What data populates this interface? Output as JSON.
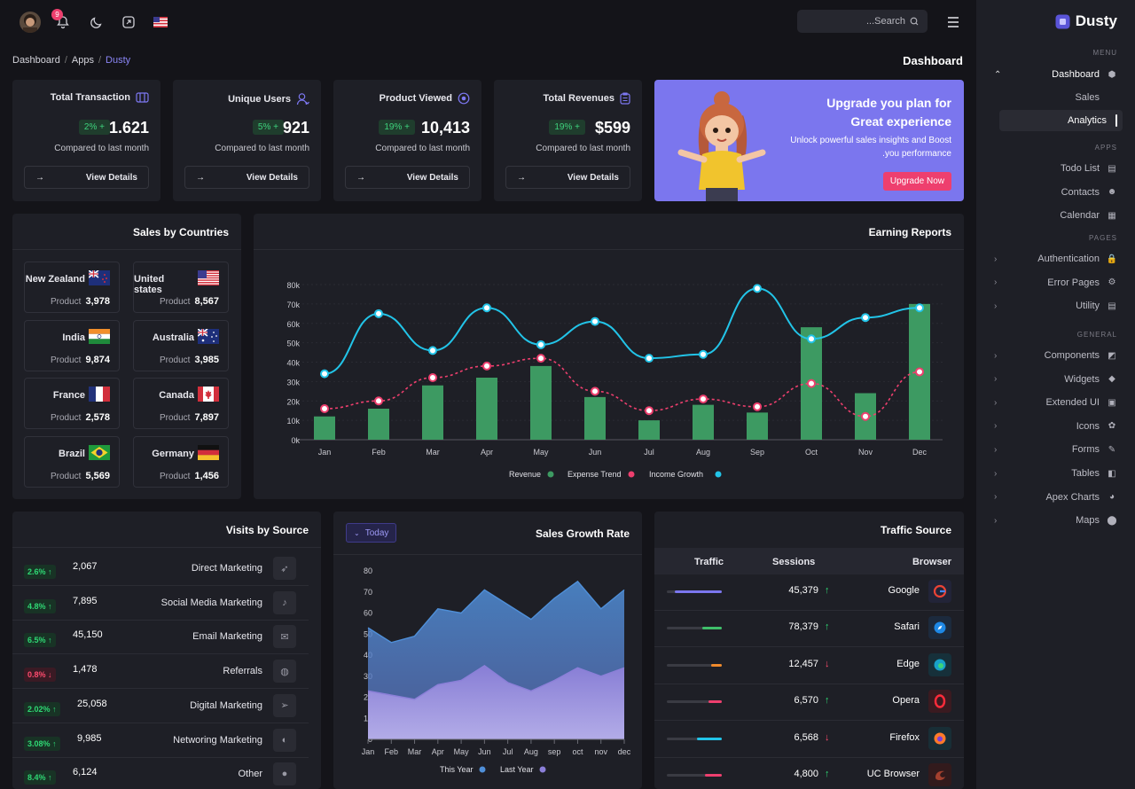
{
  "header": {
    "notif_count": "9",
    "search_placeholder": "...Search"
  },
  "breadcrumb": {
    "items": [
      "Dashboard",
      "Apps",
      "Dusty"
    ]
  },
  "page_title": "Dashboard",
  "stats": [
    {
      "title": "Total Transaction",
      "icon": "columns-icon",
      "value": "1.621",
      "pct": "2% +",
      "compare": "Compared to last month",
      "view": "View Details"
    },
    {
      "title": "Unique Users",
      "icon": "user-icon",
      "value": "921",
      "pct": "5% +",
      "compare": "Compared to last month",
      "view": "View Details"
    },
    {
      "title": "Product Viewed",
      "icon": "eye-icon",
      "value": "10,413",
      "pct": "19% +",
      "compare": "Compared to last month",
      "view": "View Details"
    },
    {
      "title": "Total Revenues",
      "icon": "clipboard-icon",
      "value": "$599",
      "pct": "19% +",
      "compare": "Compared to last month",
      "view": "View Details"
    }
  ],
  "promo": {
    "title_line1": "Upgrade you plan for",
    "title_line2": "Great experience",
    "sub_line1": "Unlock powerful sales insights and Boost",
    "sub_line2": ".you performance",
    "button": "Upgrade Now"
  },
  "countries": {
    "title": "Sales by Countries",
    "product_label": "Product",
    "items": [
      {
        "name": "New Zealand",
        "value": "3,978",
        "flag": "nz"
      },
      {
        "name": "United states",
        "value": "8,567",
        "flag": "us"
      },
      {
        "name": "India",
        "value": "9,874",
        "flag": "in"
      },
      {
        "name": "Australia",
        "value": "3,985",
        "flag": "au"
      },
      {
        "name": "France",
        "value": "2,578",
        "flag": "fr"
      },
      {
        "name": "Canada",
        "value": "7,897",
        "flag": "ca"
      },
      {
        "name": "Brazil",
        "value": "5,569",
        "flag": "br"
      },
      {
        "name": "Germany",
        "value": "1,456",
        "flag": "de"
      }
    ]
  },
  "earning": {
    "title": "Earning Reports"
  },
  "chart_data": [
    {
      "type": "bar",
      "title": "Earning Reports",
      "categories": [
        "Jan",
        "Feb",
        "Mar",
        "Apr",
        "May",
        "Jun",
        "Jul",
        "Aug",
        "Sep",
        "Oct",
        "Nov",
        "Dec"
      ],
      "ylim": [
        0,
        80000
      ],
      "yticks": [
        "0k",
        "10k",
        "20k",
        "30k",
        "40k",
        "50k",
        "60k",
        "70k",
        "80k"
      ],
      "legend": "bottom-center",
      "series": [
        {
          "name": "Revenue",
          "type": "bar",
          "color": "#3d9a62",
          "values": [
            12000,
            16000,
            28000,
            32000,
            38000,
            22000,
            10000,
            18000,
            14000,
            58000,
            24000,
            70000
          ]
        },
        {
          "name": "Expense Trend",
          "type": "line-dashed",
          "color": "#ee3f6e",
          "values": [
            16000,
            20000,
            32000,
            38000,
            42000,
            25000,
            15000,
            21000,
            17000,
            29000,
            12000,
            35000
          ]
        },
        {
          "name": "Income Growth",
          "type": "line",
          "color": "#22c4e8",
          "values": [
            34000,
            65000,
            46000,
            68000,
            49000,
            61000,
            42000,
            44000,
            78000,
            52000,
            63000,
            68000
          ]
        }
      ]
    },
    {
      "type": "area",
      "title": "Sales Growth Rate",
      "categories": [
        "Jan",
        "Feb",
        "Mar",
        "Apr",
        "May",
        "Jun",
        "Jul",
        "Aug",
        "sep",
        "oct",
        "nov",
        "dec"
      ],
      "ylim": [
        0,
        80
      ],
      "yticks": [
        "0",
        "10",
        "20",
        "30",
        "40",
        "50",
        "60",
        "70",
        "80"
      ],
      "legend": "bottom-center",
      "series": [
        {
          "name": "This Year",
          "color": "#4f8fd8",
          "values": [
            53,
            46,
            49,
            62,
            60,
            71,
            64,
            57,
            67,
            75,
            62,
            71
          ]
        },
        {
          "name": "Last Year",
          "color": "#8b7fd8",
          "values": [
            23,
            21,
            19,
            26,
            28,
            35,
            27,
            23,
            28,
            34,
            30,
            34
          ]
        }
      ]
    }
  ],
  "visits": {
    "title": "Visits by Source",
    "rows": [
      {
        "pct": "2.6% ↑",
        "dir": "up",
        "num": "2,067",
        "label": "Direct Marketing",
        "icon": "rocket-icon",
        "glyph": "➶"
      },
      {
        "pct": "4.8% ↑",
        "dir": "up",
        "num": "7,895",
        "label": "Social Media Marketing",
        "icon": "music-icon",
        "glyph": "♪"
      },
      {
        "pct": "6.5% ↑",
        "dir": "up",
        "num": "45,150",
        "label": "Email Marketing",
        "icon": "mail-icon",
        "glyph": "✉"
      },
      {
        "pct": "0.8% ↓",
        "dir": "down",
        "num": "1,478",
        "label": "Referrals",
        "icon": "globe-icon",
        "glyph": "◍"
      },
      {
        "pct": "2.02% ↑",
        "dir": "up",
        "num": "25,058",
        "label": "Digital Marketing",
        "icon": "send-icon",
        "glyph": "➢"
      },
      {
        "pct": "3.08% ↑",
        "dir": "up",
        "num": "9,985",
        "label": "Networing Marketing",
        "icon": "planet-icon",
        "glyph": "◐"
      },
      {
        "pct": "8.4% ↑",
        "dir": "up",
        "num": "6,124",
        "label": "Other",
        "icon": "fire-icon",
        "glyph": "●"
      }
    ]
  },
  "sales_growth": {
    "title": "Sales Growth Rate",
    "filter": "Today",
    "legend": [
      "This Year",
      "Last Year"
    ]
  },
  "traffic": {
    "title": "Traffic Source",
    "headers": [
      "Traffic",
      "Sessions",
      "Browser"
    ],
    "rows": [
      {
        "sessions": "45,379",
        "dir": "up",
        "browser": "Google",
        "color": "#7b76ee",
        "fill": 0.85,
        "icon_bg": "#222438"
      },
      {
        "sessions": "78,379",
        "dir": "up",
        "browser": "Safari",
        "color": "#3fbf6a",
        "fill": 0.35,
        "icon_bg": "#1c2a3d"
      },
      {
        "sessions": "12,457",
        "dir": "down",
        "browser": "Edge",
        "color": "#f08a2c",
        "fill": 0.2,
        "icon_bg": "#16303a"
      },
      {
        "sessions": "6,570",
        "dir": "up",
        "browser": "Opera",
        "color": "#ee3f6e",
        "fill": 0.25,
        "icon_bg": "#3a1a20"
      },
      {
        "sessions": "6,568",
        "dir": "down",
        "browser": "Firefox",
        "color": "#22c4e8",
        "fill": 0.45,
        "icon_bg": "#182e36"
      },
      {
        "sessions": "4,800",
        "dir": "up",
        "browser": "UC Browser",
        "color": "#ee3f6e",
        "fill": 0.3,
        "icon_bg": "#321a1c"
      }
    ]
  },
  "sidebar": {
    "brand": "Dusty",
    "sections": {
      "menu": "MENU",
      "apps": "APPS",
      "pages": "PAGES",
      "general": "GENERAL"
    },
    "dashboard": "Dashboard",
    "sub": [
      "Sales",
      "Analytics"
    ],
    "apps": [
      {
        "label": "Todo List",
        "icon": "list-icon",
        "glyph": "▤"
      },
      {
        "label": "Contacts",
        "icon": "contacts-icon",
        "glyph": "☻"
      },
      {
        "label": "Calendar",
        "icon": "calendar-icon",
        "glyph": "▦"
      }
    ],
    "pages": [
      {
        "label": "Authentication",
        "icon": "lock-icon",
        "glyph": "🔒"
      },
      {
        "label": "Error Pages",
        "icon": "settings-icon",
        "glyph": "⚙"
      },
      {
        "label": "Utility",
        "icon": "document-icon",
        "glyph": "▤"
      }
    ],
    "general": [
      {
        "label": "Components",
        "icon": "components-icon",
        "glyph": "◩"
      },
      {
        "label": "Widgets",
        "icon": "cube-icon",
        "glyph": "◆"
      },
      {
        "label": "Extended UI",
        "icon": "grid-icon",
        "glyph": "▣"
      },
      {
        "label": "Icons",
        "icon": "shapes-icon",
        "glyph": "✿"
      },
      {
        "label": "Forms",
        "icon": "form-icon",
        "glyph": "✎"
      },
      {
        "label": "Tables",
        "icon": "table-icon",
        "glyph": "◧"
      },
      {
        "label": "Apex Charts",
        "icon": "pie-chart-icon",
        "glyph": "◕"
      },
      {
        "label": "Maps",
        "icon": "map-pin-icon",
        "glyph": "⬤"
      }
    ]
  }
}
